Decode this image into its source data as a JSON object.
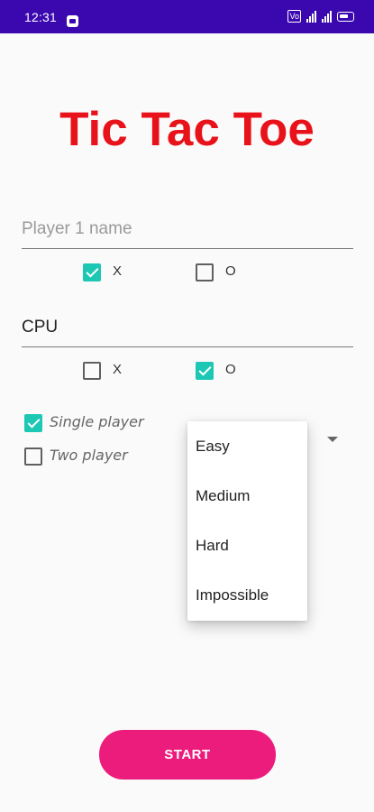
{
  "status_bar": {
    "time": "12:31",
    "volte_label": "Vo",
    "icons": [
      "app-notification-icon",
      "volte-icon",
      "signal-icon",
      "signal-icon",
      "battery-icon"
    ],
    "background": "#3b08b0"
  },
  "title": "Tic Tac Toe",
  "player1": {
    "value": "",
    "placeholder": "Player 1 name",
    "x_label": "X",
    "o_label": "O",
    "x_checked": true,
    "o_checked": false
  },
  "player2": {
    "value": "CPU",
    "x_label": "X",
    "o_label": "O",
    "x_checked": false,
    "o_checked": true
  },
  "mode": {
    "single_label": "Single player",
    "two_label": "Two player",
    "single_checked": true,
    "two_checked": false
  },
  "difficulty": {
    "options": [
      "Easy",
      "Medium",
      "Hard",
      "Impossible"
    ]
  },
  "start_label": "START",
  "colors": {
    "title": "#e8121b",
    "accent": "#1cc7b4",
    "button": "#ec1c7c"
  }
}
